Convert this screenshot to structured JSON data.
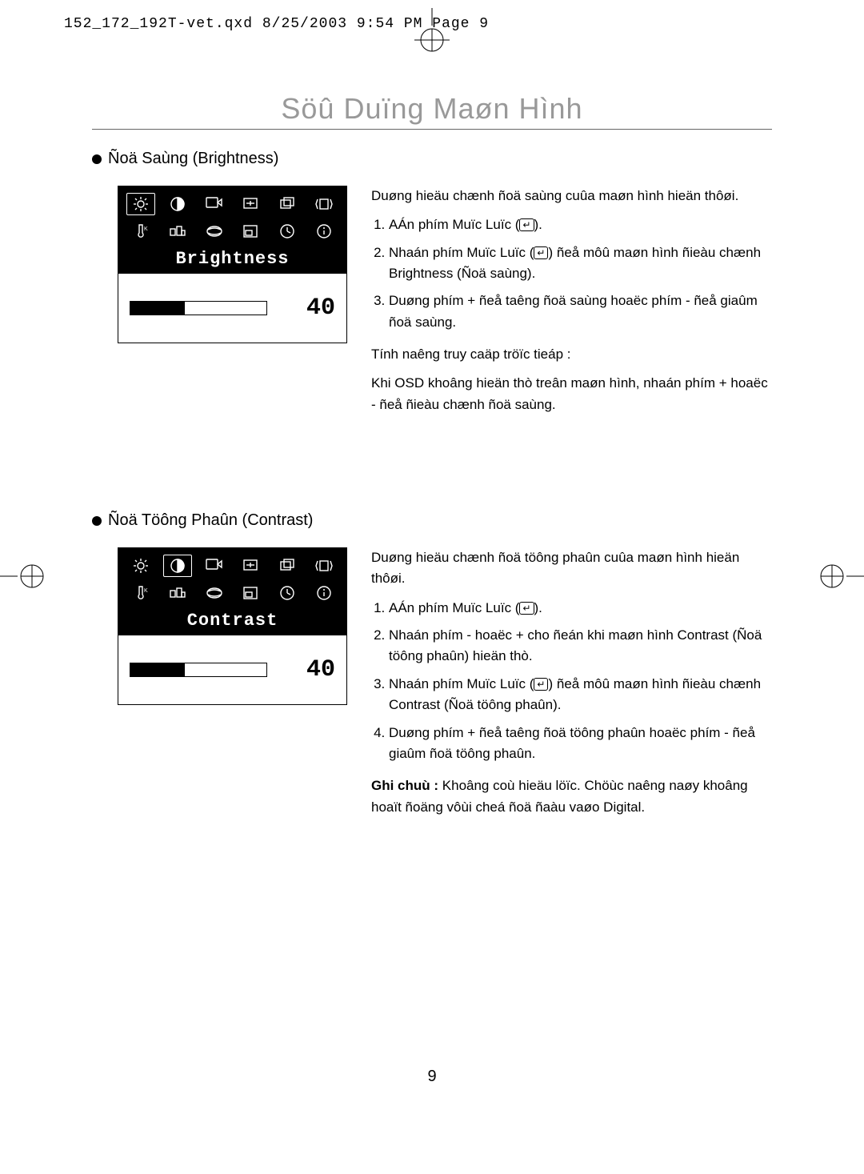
{
  "header_text": "152_172_192T-vet.qxd  8/25/2003  9:54 PM  Page 9",
  "title": "Söû Duïng Maøn Hình",
  "page_number": "9",
  "brightness": {
    "section_title": "Ñoä Saùng (Brightness)",
    "osd_label": "Brightness",
    "osd_value": "40",
    "intro": "Duøng hieäu chænh ñoä saùng cuûa maøn hình hieän thôøi.",
    "steps": [
      "AÁn phím Muïc Luïc (",
      "Nhaán phím Muïc Luïc (",
      "Duøng phím + ñeå taêng ñoä saùng hoaëc phím - ñeå giaûm ñoä saùng."
    ],
    "step2_tail": ") ñeå môû maøn hình ñieàu chænh Brightness (Ñoä saùng).",
    "step1_tail": ").",
    "tip_head": "Tính naêng truy caäp tröïc tieáp :",
    "tip_body": "Khi OSD khoâng hieän thò treân maøn hình, nhaán phím + hoaëc - ñeå ñieàu chænh ñoä saùng."
  },
  "contrast": {
    "section_title": "Ñoä Töông Phaûn (Contrast)",
    "osd_label": "Contrast",
    "osd_value": "40",
    "intro": "Duøng hieäu chænh ñoä töông phaûn cuûa maøn hình hieän thôøi.",
    "steps": [
      "AÁn phím Muïc Luïc (",
      "Nhaán phím - hoaëc + cho ñeán khi maøn hình Contrast (Ñoä töông phaûn) hieän thò.",
      "Nhaán phím Muïc Luïc (",
      "Duøng phím + ñeå taêng ñoä töông phaûn hoaëc phím - ñeå giaûm ñoä töông phaûn."
    ],
    "step1_tail": ").",
    "step3_tail": ") ñeå môû maøn hình ñieàu chænh Contrast (Ñoä töông phaûn).",
    "note_head": "Ghi chuù :",
    "note_body": " Khoâng coù hieäu löïc. Chöùc naêng naøy khoâng hoaït ñoäng vôùi cheá ñoä ñaàu vaøo Digital."
  }
}
